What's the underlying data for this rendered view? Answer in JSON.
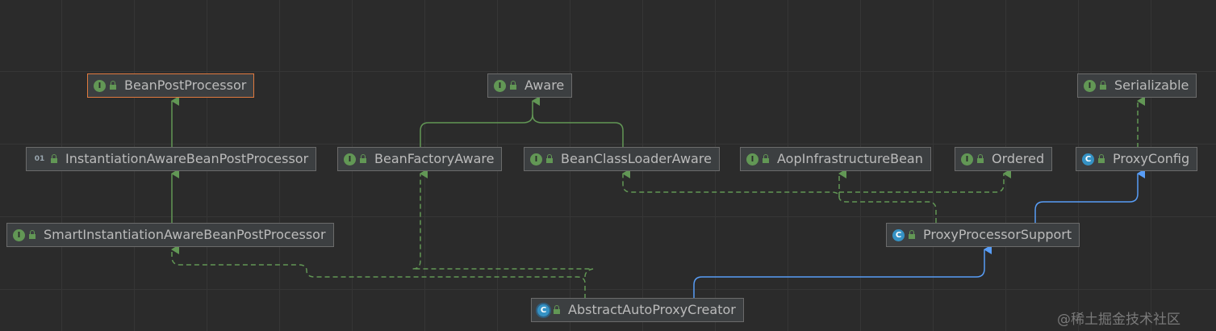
{
  "nodes": {
    "bean_post_processor": {
      "label": "BeanPostProcessor",
      "icon": "interface-icon"
    },
    "aware": {
      "label": "Aware",
      "icon": "interface-icon"
    },
    "serializable": {
      "label": "Serializable",
      "icon": "interface-icon"
    },
    "instantiation_aware": {
      "label": "InstantiationAwareBeanPostProcessor",
      "icon": "annotation-icon"
    },
    "bean_factory_aware": {
      "label": "BeanFactoryAware",
      "icon": "interface-icon"
    },
    "bean_class_loader_aware": {
      "label": "BeanClassLoaderAware",
      "icon": "interface-icon"
    },
    "aop_infrastructure_bean": {
      "label": "AopInfrastructureBean",
      "icon": "interface-icon"
    },
    "ordered": {
      "label": "Ordered",
      "icon": "interface-icon"
    },
    "proxy_config": {
      "label": "ProxyConfig",
      "icon": "class-icon"
    },
    "smart_instantiation_aware": {
      "label": "SmartInstantiationAwareBeanPostProcessor",
      "icon": "interface-icon"
    },
    "proxy_processor_support": {
      "label": "ProxyProcessorSupport",
      "icon": "class-icon"
    },
    "abstract_auto_proxy_creator": {
      "label": "AbstractAutoProxyCreator",
      "icon": "abstract-class-icon"
    }
  },
  "icon_glyphs": {
    "interface": "I",
    "class": "C",
    "abstract": "C",
    "annotation": "01"
  },
  "colors": {
    "background": "#2b2b2b",
    "node_fill": "#3c3f41",
    "node_border": "#6b6b6b",
    "selected_border": "#e07a3f",
    "interface_edge": "#629755",
    "class_edge": "#589df6",
    "text": "#bbbbbb"
  },
  "watermark": "@稀土掘金技术社区"
}
